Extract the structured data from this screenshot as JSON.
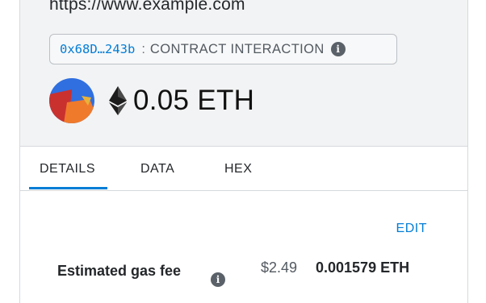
{
  "origin": "https://www.example.com",
  "contract": {
    "address": "0x68D…243b",
    "separator": ":",
    "method": "CONTRACT INTERACTION",
    "info_icon": "info-icon"
  },
  "amount": {
    "value": "0.05 ETH",
    "token_icon": "ethereum-icon"
  },
  "tabs": [
    {
      "label": "DETAILS",
      "active": true
    },
    {
      "label": "DATA",
      "active": false
    },
    {
      "label": "HEX",
      "active": false
    }
  ],
  "details": {
    "edit_label": "EDIT",
    "gas_label": "Estimated gas fee",
    "gas_fiat": "$2.49",
    "gas_eth": "0.001579 ETH",
    "info_icon": "info-icon"
  },
  "colors": {
    "accent": "#037dd6",
    "header_bg": "#f2f3f4",
    "border": "#d6d9dc",
    "avatar_blue": "#2f6fe0",
    "avatar_red": "#c9312f",
    "avatar_orange": "#f07a2b"
  }
}
